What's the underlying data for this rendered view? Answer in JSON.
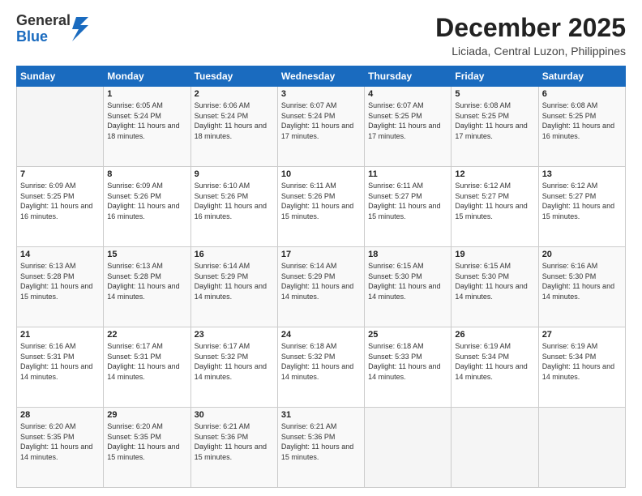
{
  "logo": {
    "general": "General",
    "blue": "Blue"
  },
  "title": "December 2025",
  "location": "Liciada, Central Luzon, Philippines",
  "days_header": [
    "Sunday",
    "Monday",
    "Tuesday",
    "Wednesday",
    "Thursday",
    "Friday",
    "Saturday"
  ],
  "weeks": [
    [
      {
        "day": "",
        "sunrise": "",
        "sunset": "",
        "daylight": ""
      },
      {
        "day": "1",
        "sunrise": "Sunrise: 6:05 AM",
        "sunset": "Sunset: 5:24 PM",
        "daylight": "Daylight: 11 hours and 18 minutes."
      },
      {
        "day": "2",
        "sunrise": "Sunrise: 6:06 AM",
        "sunset": "Sunset: 5:24 PM",
        "daylight": "Daylight: 11 hours and 18 minutes."
      },
      {
        "day": "3",
        "sunrise": "Sunrise: 6:07 AM",
        "sunset": "Sunset: 5:24 PM",
        "daylight": "Daylight: 11 hours and 17 minutes."
      },
      {
        "day": "4",
        "sunrise": "Sunrise: 6:07 AM",
        "sunset": "Sunset: 5:25 PM",
        "daylight": "Daylight: 11 hours and 17 minutes."
      },
      {
        "day": "5",
        "sunrise": "Sunrise: 6:08 AM",
        "sunset": "Sunset: 5:25 PM",
        "daylight": "Daylight: 11 hours and 17 minutes."
      },
      {
        "day": "6",
        "sunrise": "Sunrise: 6:08 AM",
        "sunset": "Sunset: 5:25 PM",
        "daylight": "Daylight: 11 hours and 16 minutes."
      }
    ],
    [
      {
        "day": "7",
        "sunrise": "Sunrise: 6:09 AM",
        "sunset": "Sunset: 5:25 PM",
        "daylight": "Daylight: 11 hours and 16 minutes."
      },
      {
        "day": "8",
        "sunrise": "Sunrise: 6:09 AM",
        "sunset": "Sunset: 5:26 PM",
        "daylight": "Daylight: 11 hours and 16 minutes."
      },
      {
        "day": "9",
        "sunrise": "Sunrise: 6:10 AM",
        "sunset": "Sunset: 5:26 PM",
        "daylight": "Daylight: 11 hours and 16 minutes."
      },
      {
        "day": "10",
        "sunrise": "Sunrise: 6:11 AM",
        "sunset": "Sunset: 5:26 PM",
        "daylight": "Daylight: 11 hours and 15 minutes."
      },
      {
        "day": "11",
        "sunrise": "Sunrise: 6:11 AM",
        "sunset": "Sunset: 5:27 PM",
        "daylight": "Daylight: 11 hours and 15 minutes."
      },
      {
        "day": "12",
        "sunrise": "Sunrise: 6:12 AM",
        "sunset": "Sunset: 5:27 PM",
        "daylight": "Daylight: 11 hours and 15 minutes."
      },
      {
        "day": "13",
        "sunrise": "Sunrise: 6:12 AM",
        "sunset": "Sunset: 5:27 PM",
        "daylight": "Daylight: 11 hours and 15 minutes."
      }
    ],
    [
      {
        "day": "14",
        "sunrise": "Sunrise: 6:13 AM",
        "sunset": "Sunset: 5:28 PM",
        "daylight": "Daylight: 11 hours and 15 minutes."
      },
      {
        "day": "15",
        "sunrise": "Sunrise: 6:13 AM",
        "sunset": "Sunset: 5:28 PM",
        "daylight": "Daylight: 11 hours and 14 minutes."
      },
      {
        "day": "16",
        "sunrise": "Sunrise: 6:14 AM",
        "sunset": "Sunset: 5:29 PM",
        "daylight": "Daylight: 11 hours and 14 minutes."
      },
      {
        "day": "17",
        "sunrise": "Sunrise: 6:14 AM",
        "sunset": "Sunset: 5:29 PM",
        "daylight": "Daylight: 11 hours and 14 minutes."
      },
      {
        "day": "18",
        "sunrise": "Sunrise: 6:15 AM",
        "sunset": "Sunset: 5:30 PM",
        "daylight": "Daylight: 11 hours and 14 minutes."
      },
      {
        "day": "19",
        "sunrise": "Sunrise: 6:15 AM",
        "sunset": "Sunset: 5:30 PM",
        "daylight": "Daylight: 11 hours and 14 minutes."
      },
      {
        "day": "20",
        "sunrise": "Sunrise: 6:16 AM",
        "sunset": "Sunset: 5:30 PM",
        "daylight": "Daylight: 11 hours and 14 minutes."
      }
    ],
    [
      {
        "day": "21",
        "sunrise": "Sunrise: 6:16 AM",
        "sunset": "Sunset: 5:31 PM",
        "daylight": "Daylight: 11 hours and 14 minutes."
      },
      {
        "day": "22",
        "sunrise": "Sunrise: 6:17 AM",
        "sunset": "Sunset: 5:31 PM",
        "daylight": "Daylight: 11 hours and 14 minutes."
      },
      {
        "day": "23",
        "sunrise": "Sunrise: 6:17 AM",
        "sunset": "Sunset: 5:32 PM",
        "daylight": "Daylight: 11 hours and 14 minutes."
      },
      {
        "day": "24",
        "sunrise": "Sunrise: 6:18 AM",
        "sunset": "Sunset: 5:32 PM",
        "daylight": "Daylight: 11 hours and 14 minutes."
      },
      {
        "day": "25",
        "sunrise": "Sunrise: 6:18 AM",
        "sunset": "Sunset: 5:33 PM",
        "daylight": "Daylight: 11 hours and 14 minutes."
      },
      {
        "day": "26",
        "sunrise": "Sunrise: 6:19 AM",
        "sunset": "Sunset: 5:34 PM",
        "daylight": "Daylight: 11 hours and 14 minutes."
      },
      {
        "day": "27",
        "sunrise": "Sunrise: 6:19 AM",
        "sunset": "Sunset: 5:34 PM",
        "daylight": "Daylight: 11 hours and 14 minutes."
      }
    ],
    [
      {
        "day": "28",
        "sunrise": "Sunrise: 6:20 AM",
        "sunset": "Sunset: 5:35 PM",
        "daylight": "Daylight: 11 hours and 14 minutes."
      },
      {
        "day": "29",
        "sunrise": "Sunrise: 6:20 AM",
        "sunset": "Sunset: 5:35 PM",
        "daylight": "Daylight: 11 hours and 15 minutes."
      },
      {
        "day": "30",
        "sunrise": "Sunrise: 6:21 AM",
        "sunset": "Sunset: 5:36 PM",
        "daylight": "Daylight: 11 hours and 15 minutes."
      },
      {
        "day": "31",
        "sunrise": "Sunrise: 6:21 AM",
        "sunset": "Sunset: 5:36 PM",
        "daylight": "Daylight: 11 hours and 15 minutes."
      },
      {
        "day": "",
        "sunrise": "",
        "sunset": "",
        "daylight": ""
      },
      {
        "day": "",
        "sunrise": "",
        "sunset": "",
        "daylight": ""
      },
      {
        "day": "",
        "sunrise": "",
        "sunset": "",
        "daylight": ""
      }
    ]
  ]
}
